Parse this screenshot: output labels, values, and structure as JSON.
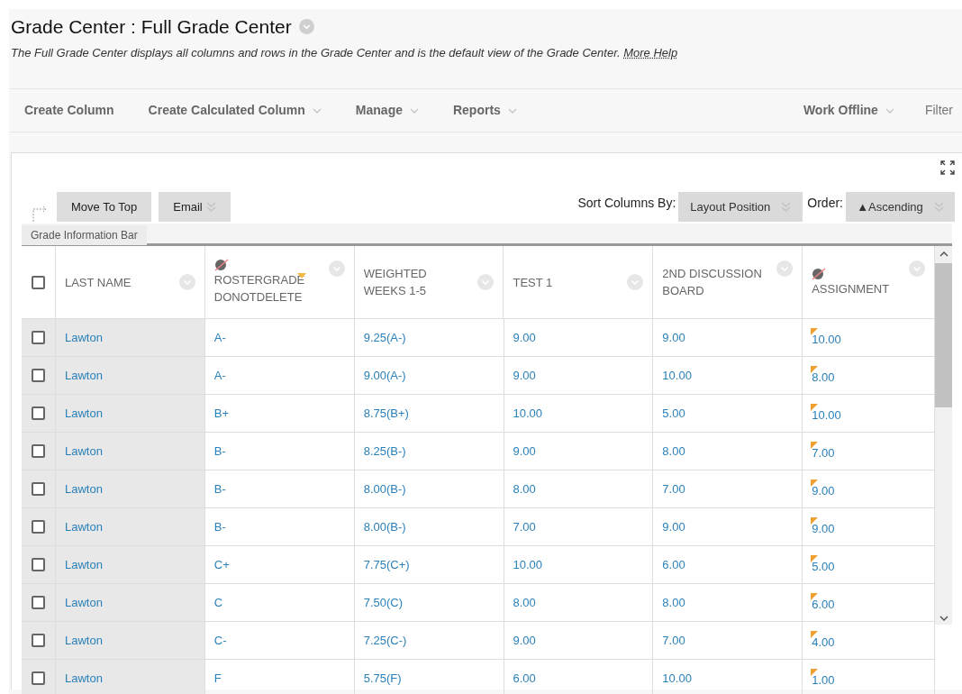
{
  "title": "Grade Center : Full Grade Center",
  "description": "The Full Grade Center displays all columns and rows in the Grade Center and is the default view of the Grade Center.",
  "help_link": "More Help",
  "menu": [
    {
      "label": "Create Column",
      "dropdown": false
    },
    {
      "label": "Create Calculated Column",
      "dropdown": true
    },
    {
      "label": "Manage",
      "dropdown": true
    },
    {
      "label": "Reports",
      "dropdown": true
    },
    {
      "label": "Work Offline",
      "dropdown": true
    },
    {
      "label": "Filter",
      "dropdown": false
    }
  ],
  "actions": [
    {
      "label": "Move To Top",
      "dropdown": false
    },
    {
      "label": "Email",
      "dropdown": true
    }
  ],
  "sort": {
    "label": "Sort Columns By:",
    "value": "Layout Position",
    "order_label": "Order:",
    "order_value": "▲Ascending"
  },
  "info_bar": "Grade Information Bar",
  "select_all_checked": false,
  "columns": [
    {
      "label": "LAST NAME",
      "hidden": false,
      "flagged": false
    },
    {
      "label": "ROSTERGRADE DONOTDELETE",
      "hidden": true,
      "flagged": true
    },
    {
      "label": "WEIGHTED WEEKS 1-5",
      "hidden": false,
      "flagged": false
    },
    {
      "label": "TEST 1",
      "hidden": false,
      "flagged": false
    },
    {
      "label": "2ND DISCUSSION BOARD",
      "hidden": false,
      "flagged": false
    },
    {
      "label": "ASSIGNMENT",
      "hidden": true,
      "flagged": false
    }
  ],
  "rows": [
    {
      "checked": false,
      "cells": [
        "Lawton",
        "A-",
        "9.25(A-)",
        "9.00",
        "9.00",
        "10.00"
      ],
      "needs_grading": true
    },
    {
      "checked": false,
      "cells": [
        "Lawton",
        "A-",
        "9.00(A-)",
        "9.00",
        "10.00",
        "8.00"
      ],
      "needs_grading": true
    },
    {
      "checked": false,
      "cells": [
        "Lawton",
        "B+",
        "8.75(B+)",
        "10.00",
        "5.00",
        "10.00"
      ],
      "needs_grading": true
    },
    {
      "checked": false,
      "cells": [
        "Lawton",
        "B-",
        "8.25(B-)",
        "9.00",
        "8.00",
        "7.00"
      ],
      "needs_grading": true
    },
    {
      "checked": false,
      "cells": [
        "Lawton",
        "B-",
        "8.00(B-)",
        "8.00",
        "7.00",
        "9.00"
      ],
      "needs_grading": true
    },
    {
      "checked": false,
      "cells": [
        "Lawton",
        "B-",
        "8.00(B-)",
        "7.00",
        "9.00",
        "9.00"
      ],
      "needs_grading": true
    },
    {
      "checked": false,
      "cells": [
        "Lawton",
        "C+",
        "7.75(C+)",
        "10.00",
        "6.00",
        "5.00"
      ],
      "needs_grading": true
    },
    {
      "checked": false,
      "cells": [
        "Lawton",
        "C",
        "7.50(C)",
        "8.00",
        "8.00",
        "6.00"
      ],
      "needs_grading": true
    },
    {
      "checked": false,
      "cells": [
        "Lawton",
        "C-",
        "7.25(C-)",
        "9.00",
        "7.00",
        "4.00"
      ],
      "needs_grading": true
    },
    {
      "checked": false,
      "cells": [
        "Lawton",
        "F",
        "5.75(F)",
        "6.00",
        "10.00",
        "1.00"
      ],
      "needs_grading": true
    }
  ]
}
